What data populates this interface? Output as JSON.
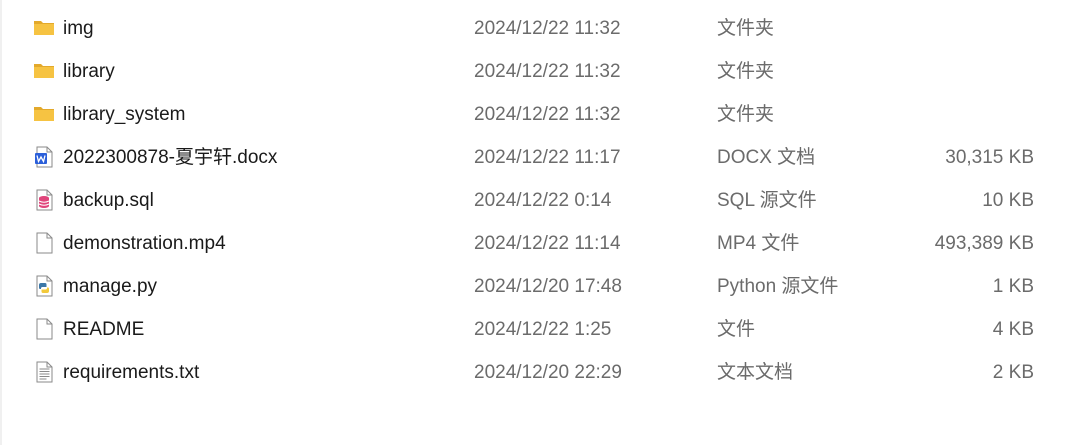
{
  "files": [
    {
      "name": "img",
      "modified": "2024/12/22 11:32",
      "type": "文件夹",
      "size": "",
      "icon": "folder-icon"
    },
    {
      "name": "library",
      "modified": "2024/12/22 11:32",
      "type": "文件夹",
      "size": "",
      "icon": "folder-icon"
    },
    {
      "name": "library_system",
      "modified": "2024/12/22 11:32",
      "type": "文件夹",
      "size": "",
      "icon": "folder-icon"
    },
    {
      "name": "2022300878-夏宇轩.docx",
      "modified": "2024/12/22 11:17",
      "type": "DOCX 文档",
      "size": "30,315 KB",
      "icon": "word-document-icon"
    },
    {
      "name": "backup.sql",
      "modified": "2024/12/22 0:14",
      "type": "SQL 源文件",
      "size": "10 KB",
      "icon": "database-file-icon"
    },
    {
      "name": "demonstration.mp4",
      "modified": "2024/12/22 11:14",
      "type": "MP4 文件",
      "size": "493,389 KB",
      "icon": "blank-file-icon"
    },
    {
      "name": "manage.py",
      "modified": "2024/12/20 17:48",
      "type": "Python 源文件",
      "size": "1 KB",
      "icon": "python-file-icon"
    },
    {
      "name": "README",
      "modified": "2024/12/22 1:25",
      "type": "文件",
      "size": "4 KB",
      "icon": "blank-file-icon"
    },
    {
      "name": "requirements.txt",
      "modified": "2024/12/20 22:29",
      "type": "文本文档",
      "size": "2 KB",
      "icon": "text-file-icon"
    }
  ],
  "colors": {
    "folder": "#f6c342",
    "folder_dark": "#e3a92b",
    "word": "#2b5fd9",
    "database": "#e0457b",
    "python_blue": "#3b77a8",
    "python_yellow": "#f2c93a"
  }
}
